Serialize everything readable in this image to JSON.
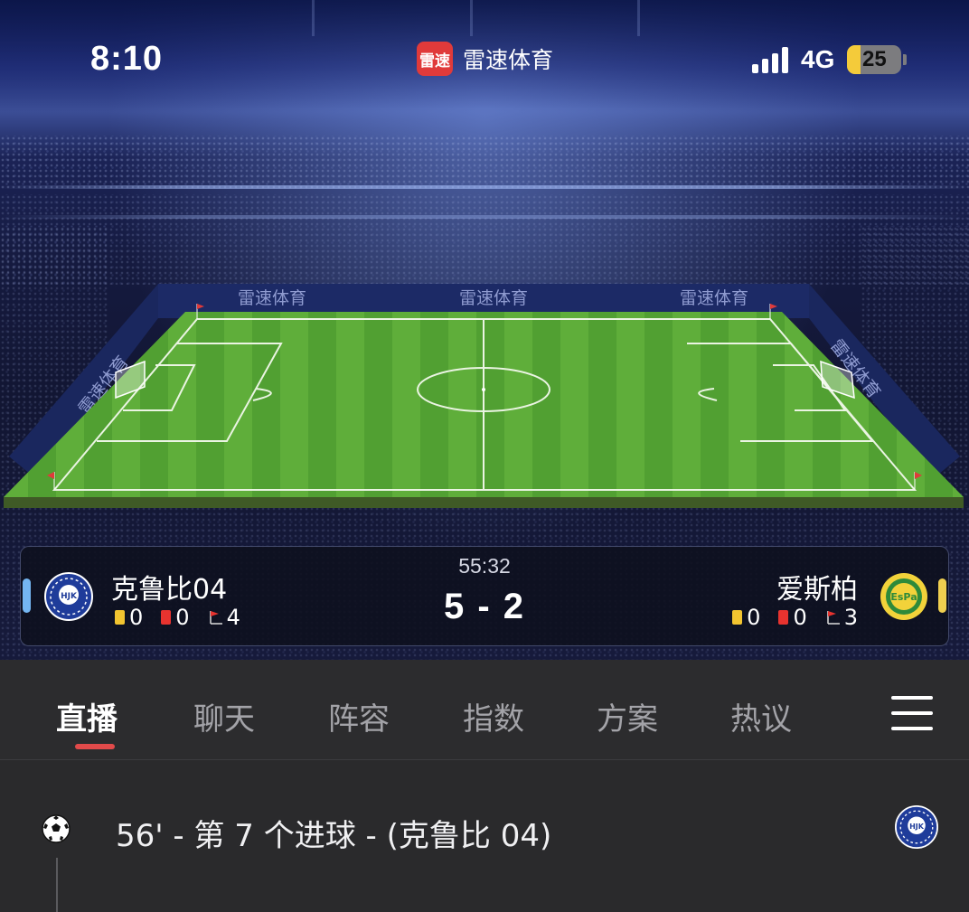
{
  "status_bar": {
    "time": "8:10",
    "app_name": "雷速体育",
    "app_logo_text": "雷速",
    "network": "4G",
    "battery": "25",
    "battery_level_percent": 25,
    "signal_bars": 4
  },
  "pitch": {
    "board_text": "雷速体育"
  },
  "match": {
    "clock": "55:32",
    "score": "5 - 2",
    "home": {
      "name": "克鲁比04",
      "yellow_cards": "0",
      "red_cards": "0",
      "corners": "4",
      "color": "#74b6f2",
      "logo_icon": "hjk-crest-icon"
    },
    "away": {
      "name": "爱斯柏",
      "yellow_cards": "0",
      "red_cards": "0",
      "corners": "3",
      "color": "#f0cf4f",
      "logo_icon": "espoo-crest-icon"
    }
  },
  "tabs": [
    {
      "label": "直播",
      "active": true
    },
    {
      "label": "聊天"
    },
    {
      "label": "阵容"
    },
    {
      "label": "指数"
    },
    {
      "label": "方案"
    },
    {
      "label": "热议"
    }
  ],
  "feed": {
    "events": [
      {
        "text": "56' - 第 7 个进球 - (克鲁比 04)",
        "icon": "soccer-ball-icon",
        "team_icon": "hjk-crest-icon"
      }
    ]
  },
  "colors": {
    "accent": "#e14a4a",
    "grass_light": "#5fae3a",
    "grass_dark": "#4f9b30"
  }
}
